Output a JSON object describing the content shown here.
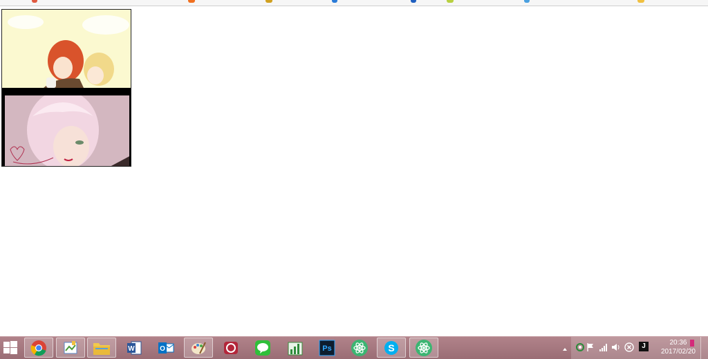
{
  "viewer": {
    "images": [
      {
        "name": "illustration-two-characters"
      },
      {
        "name": "illustration-pink-hair-character"
      }
    ]
  },
  "taskbar": {
    "start_icon": "windows-logo-icon",
    "apps": [
      {
        "icon": "chrome-icon",
        "active": true
      },
      {
        "icon": "paint-icon",
        "active": true
      },
      {
        "icon": "file-explorer-icon",
        "active": true
      },
      {
        "icon": "word-icon",
        "active": false
      },
      {
        "icon": "outlook-icon",
        "active": false
      },
      {
        "icon": "paint-palette-icon",
        "active": true
      },
      {
        "icon": "red-app-icon",
        "active": false
      },
      {
        "icon": "line-icon",
        "active": false
      },
      {
        "icon": "stats-app-icon",
        "active": false
      },
      {
        "icon": "photoshop-icon",
        "active": false
      },
      {
        "icon": "atom-icon",
        "active": false
      },
      {
        "icon": "skype-icon",
        "active": true
      },
      {
        "icon": "atom-icon",
        "active": true
      }
    ],
    "photoshop_label": "Ps",
    "word_label": "W",
    "outlook_label": "O"
  },
  "tray": {
    "time": "20:36",
    "date": "2017/02/20",
    "icons": [
      "show-hidden-icons-icon",
      "sync-icon",
      "flag-icon",
      "signal-icon",
      "volume-icon",
      "close-circle-icon",
      "ime-icon"
    ],
    "ime_label": "J"
  }
}
